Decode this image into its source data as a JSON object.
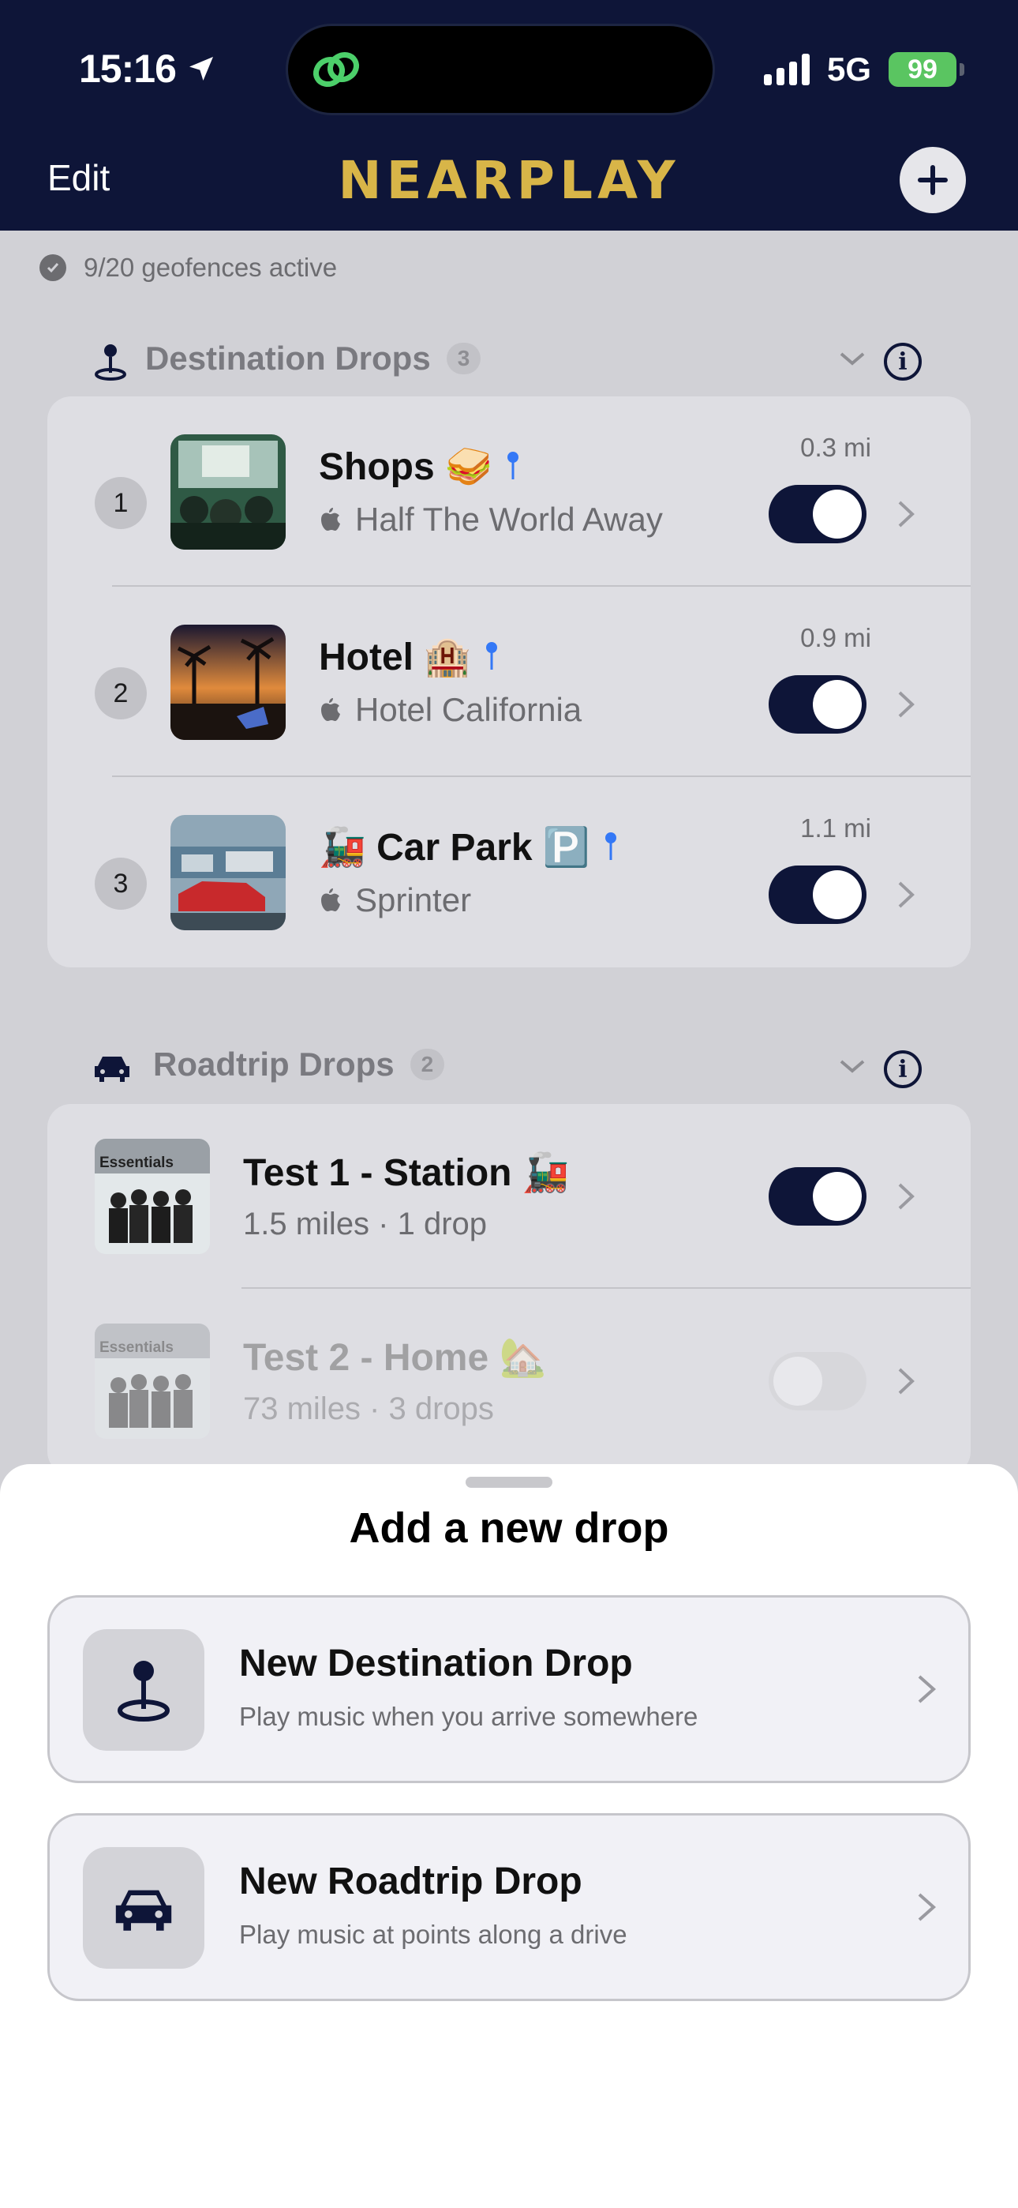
{
  "status_bar": {
    "time": "15:16",
    "network": "5G",
    "battery": "99"
  },
  "nav": {
    "edit_label": "Edit",
    "title": "NEARPLAY",
    "add_icon": "plus-icon"
  },
  "geofence_status": "9/20 geofences active",
  "destination_section": {
    "title": "Destination Drops",
    "count": "3",
    "rows": [
      {
        "index": "1",
        "title": "Shops 🥪",
        "song": "Half The World Away",
        "distance": "0.3 mi",
        "enabled": true
      },
      {
        "index": "2",
        "title": "Hotel 🏨",
        "song": "Hotel California",
        "distance": "0.9 mi",
        "enabled": true
      },
      {
        "index": "3",
        "title": "🚂 Car Park 🅿️",
        "song": "Sprinter",
        "distance": "1.1 mi",
        "enabled": true
      }
    ]
  },
  "roadtrip_section": {
    "title": "Roadtrip Drops",
    "count": "2",
    "artwork_label": "Essentials",
    "rows": [
      {
        "title": "Test 1 - Station 🚂",
        "subtitle": "1.5 miles · 1 drop",
        "enabled": true
      },
      {
        "title": "Test 2 - Home 🏡",
        "subtitle": "73 miles · 3 drops",
        "enabled": false
      }
    ]
  },
  "sheet": {
    "title": "Add a new drop",
    "options": [
      {
        "title": "New Destination Drop",
        "subtitle": "Play music when you arrive somewhere",
        "icon": "map-pin-icon"
      },
      {
        "title": "New Roadtrip Drop",
        "subtitle": "Play music at points along a drive",
        "icon": "car-icon"
      }
    ]
  },
  "colors": {
    "navy": "#0e1538",
    "gold": "#d8b548",
    "battery_green": "#5ac561"
  }
}
